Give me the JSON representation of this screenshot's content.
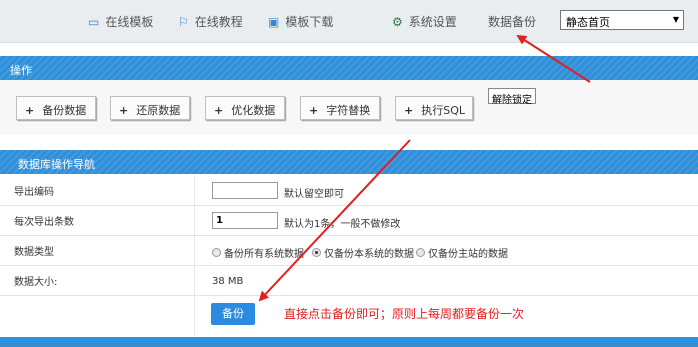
{
  "topbar": {
    "nav": [
      {
        "label": "在线模板",
        "icon": "monitor-icon"
      },
      {
        "label": "在线教程",
        "icon": "book-icon"
      },
      {
        "label": "模板下载",
        "icon": "download-icon"
      },
      {
        "label": "系统设置",
        "icon": "gear-icon"
      },
      {
        "label": "数据备份"
      }
    ],
    "select_value": "静态首页"
  },
  "ops": {
    "title": "操作",
    "buttons": [
      "备份数据",
      "还原数据",
      "优化数据",
      "字符替换",
      "执行SQL"
    ],
    "unlock": "解除锁定"
  },
  "db_nav": {
    "title": "数据库操作导航",
    "rows": {
      "encoding": {
        "label": "导出编码",
        "value": "",
        "hint": "默认留空即可"
      },
      "per_export": {
        "label": "每次导出条数",
        "value": "1",
        "hint": "默认为1条，一般不做修改"
      },
      "data_type": {
        "label": "数据类型",
        "options": [
          "备份所有系统数据",
          "仅备份本系统的数据",
          "仅备份主站的数据"
        ],
        "selected": 1
      },
      "data_size": {
        "label": "数据大小:",
        "value": "38 MB"
      }
    },
    "backup_button": "备份",
    "annotation": "直接点击备份即可；原则上每周都要备份一次"
  },
  "colors": {
    "accent": "#2f8fd8",
    "annotation": "#e02020"
  }
}
